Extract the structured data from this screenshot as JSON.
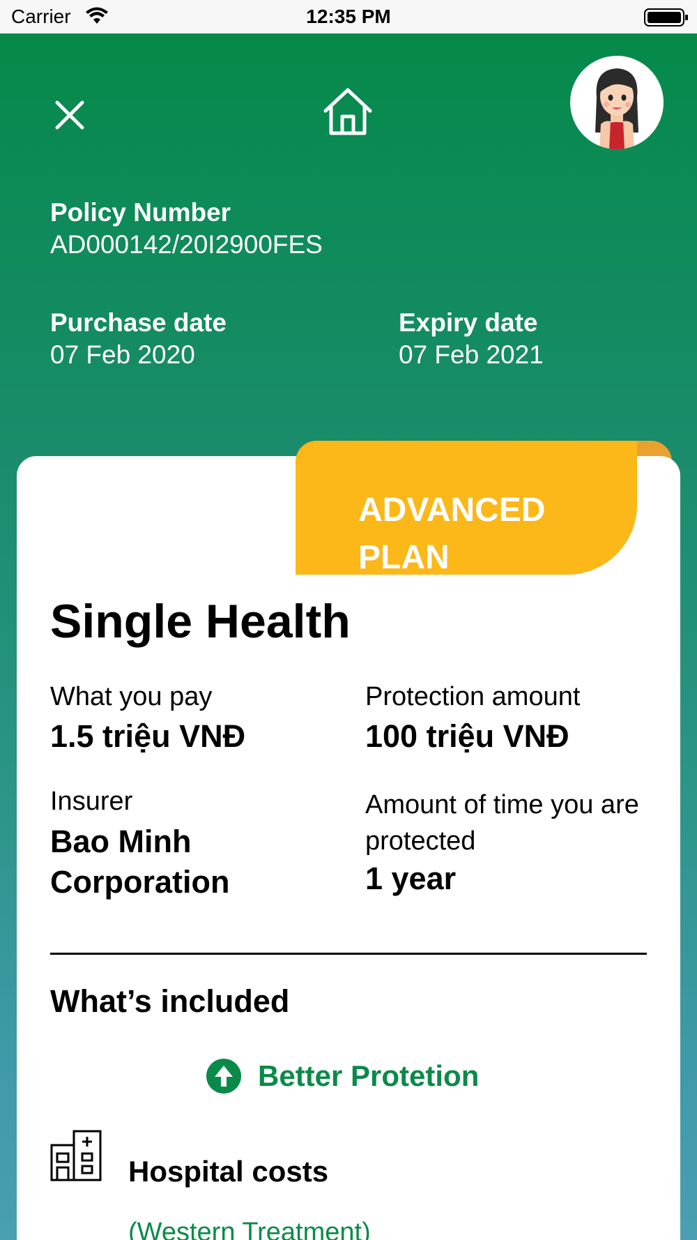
{
  "status_bar": {
    "carrier": "Carrier",
    "time": "12:35 PM"
  },
  "header": {
    "close_icon": "close-icon",
    "home_icon": "home-icon",
    "avatar": "user-avatar",
    "policy_number_label": "Policy Number",
    "policy_number_value": "AD000142/20I2900FES",
    "purchase_date_label": "Purchase date",
    "purchase_date_value": "07 Feb 2020",
    "expiry_date_label": "Expiry date",
    "expiry_date_value": "07 Feb 2021"
  },
  "card": {
    "ribbon_label": "ADVANCED PLAN",
    "product_title": "Single Health",
    "what_you_pay_label": "What you pay",
    "what_you_pay_value": "1.5 triệu VNĐ",
    "protection_amount_label": "Protection amount",
    "protection_amount_value": "100 triệu VNĐ",
    "insurer_label": "Insurer",
    "insurer_value": "Bao Minh Corporation",
    "protected_time_label": "Amount of time you are protected",
    "protected_time_value": "1 year",
    "whats_included_title": "What’s included",
    "better_protection": "Better Protetion",
    "hospital_costs": "Hospital costs",
    "hospital_costs_sub": "(Western Treatment)"
  },
  "colors": {
    "brand_green": "#058a4a",
    "ribbon_yellow": "#fcb718",
    "accent_green_text": "#0a8a48"
  }
}
